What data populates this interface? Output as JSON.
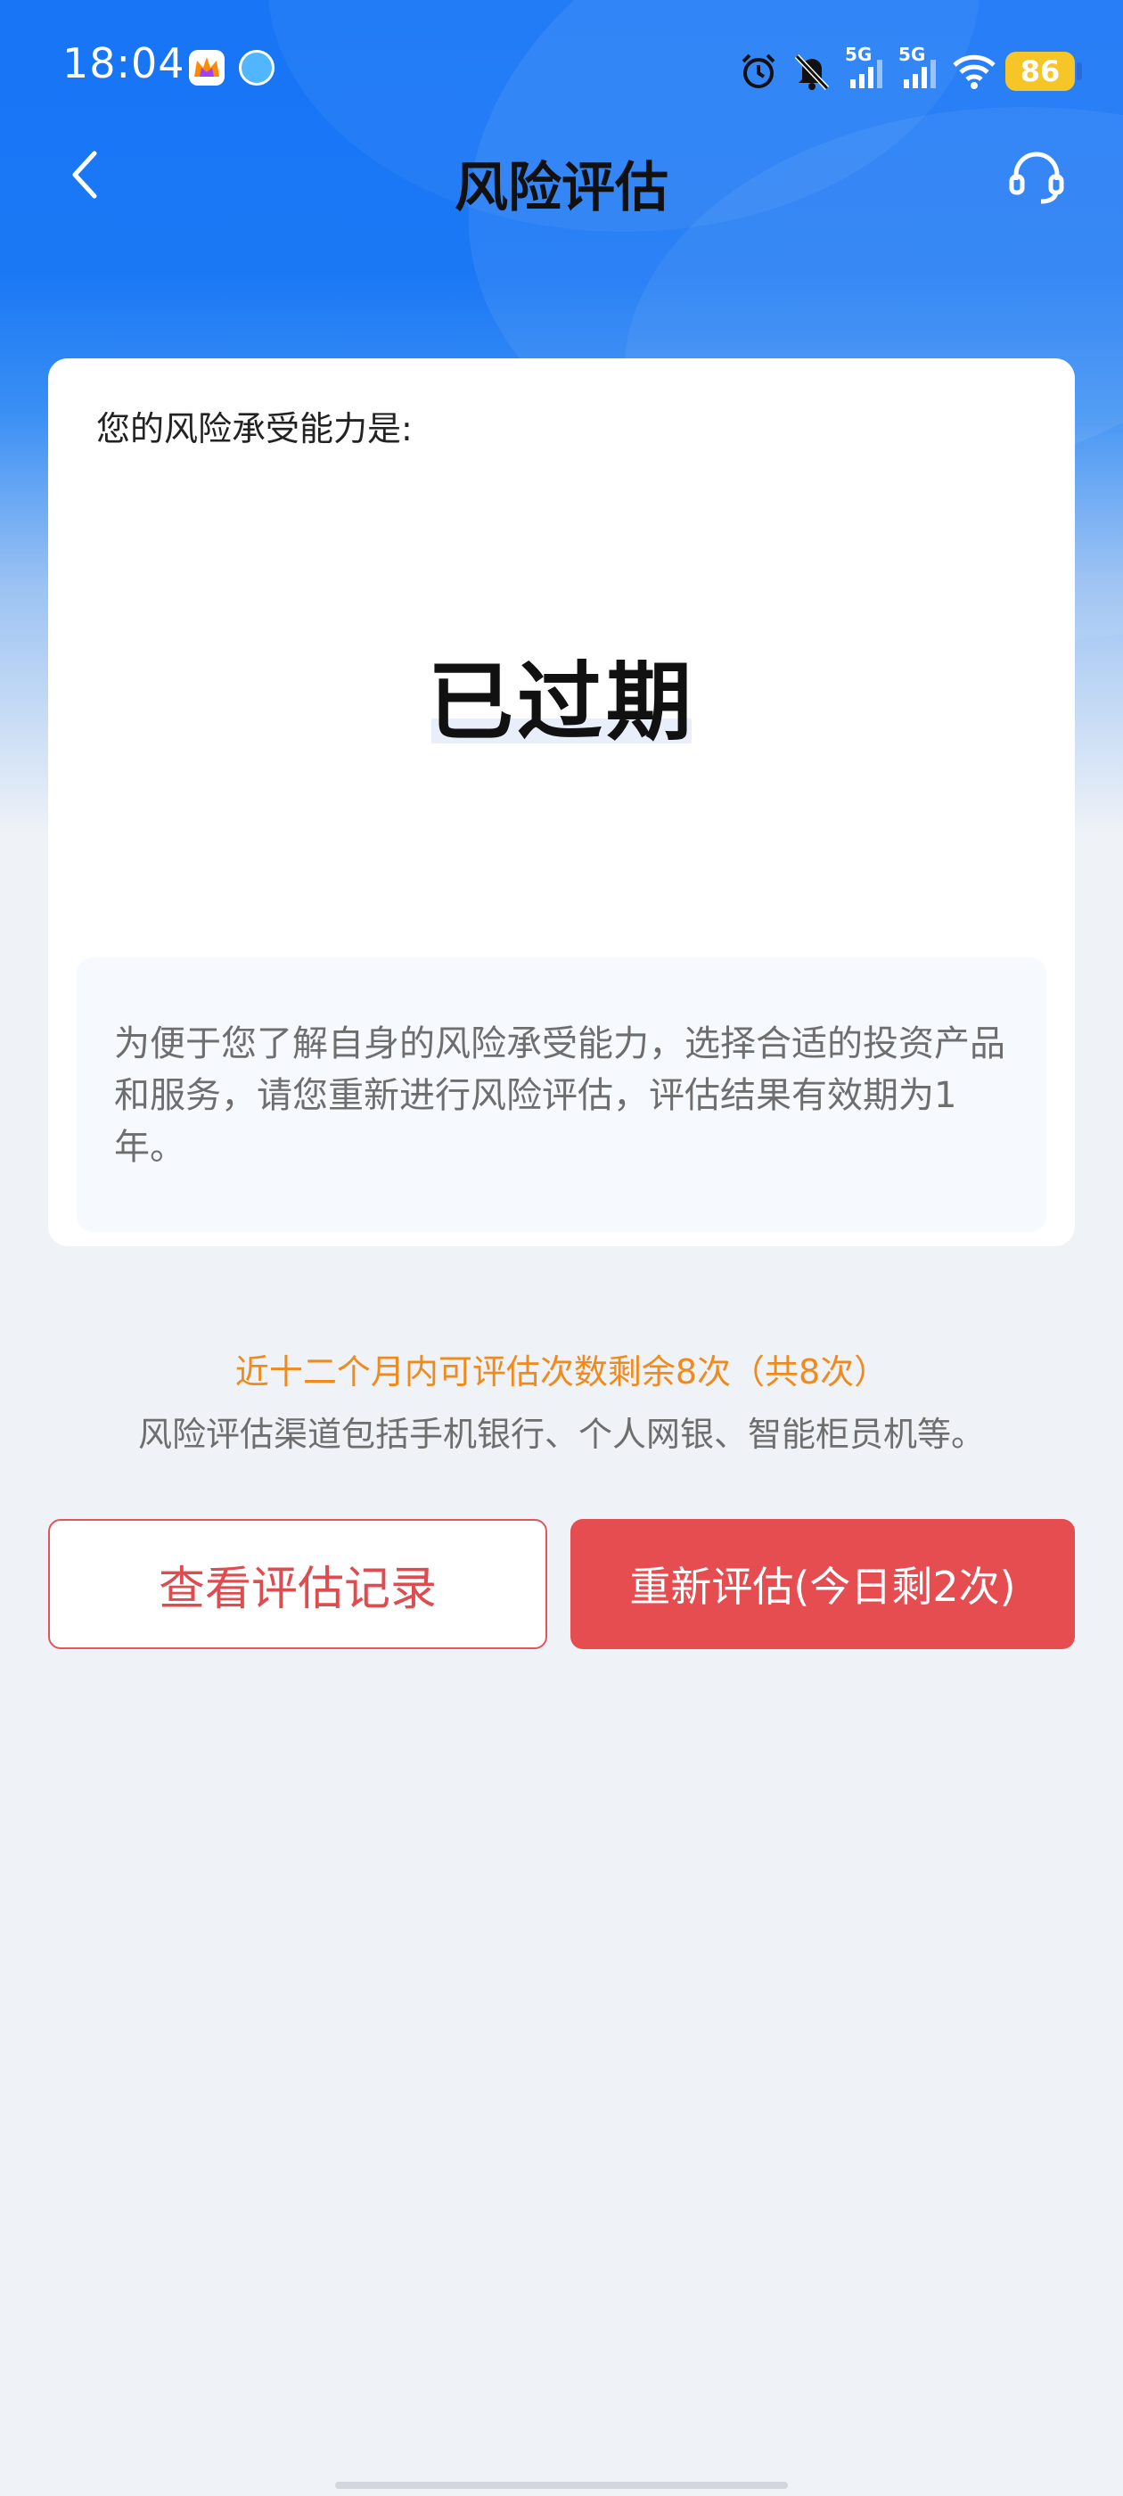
{
  "status_bar": {
    "time": "18:04",
    "signal1_label": "5G",
    "signal2_label": "5G",
    "battery": "86"
  },
  "nav": {
    "title": "风险评估"
  },
  "card": {
    "label": "您的风险承受能力是:",
    "result": "已过期",
    "note": "为便于您了解自身的风险承受能力，选择合适的投资产品和服务，请您重新进行风险评估，评估结果有效期为1年。"
  },
  "info": {
    "remaining": "近十二个月内可评估次数剩余8次（共8次）",
    "channels": "风险评估渠道包括手机银行、个人网银、智能柜员机等。"
  },
  "buttons": {
    "view_records": "查看评估记录",
    "reassess": "重新评估(今日剩2次)"
  },
  "colors": {
    "header_blue": "#1775f6",
    "accent_red": "#e64d51",
    "warning_orange": "#ef8a1c",
    "page_bg": "#eff2f7"
  }
}
